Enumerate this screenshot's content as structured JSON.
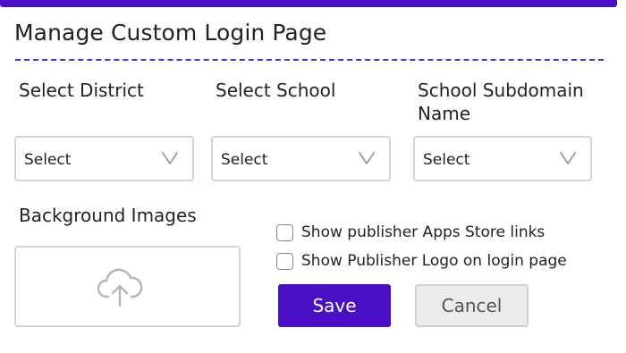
{
  "header": {
    "title": "Manage Custom Login Page"
  },
  "fields": {
    "district": {
      "label": "Select District",
      "value": "Select"
    },
    "school": {
      "label": "Select School",
      "value": "Select"
    },
    "subdomain": {
      "label": "School Subdomain Name",
      "value": "Select"
    }
  },
  "background": {
    "label": "Background Images",
    "upload_icon": "cloud-upload-icon"
  },
  "options": {
    "apps_store_links": {
      "label": "Show publisher Apps Store links",
      "checked": false
    },
    "publisher_logo": {
      "label": "Show Publisher Logo on login page",
      "checked": false
    }
  },
  "actions": {
    "save_label": "Save",
    "cancel_label": "Cancel"
  },
  "colors": {
    "accent": "#4a0fc3",
    "divider": "#5a2ad6",
    "cancel_bg": "#ebebeb"
  }
}
